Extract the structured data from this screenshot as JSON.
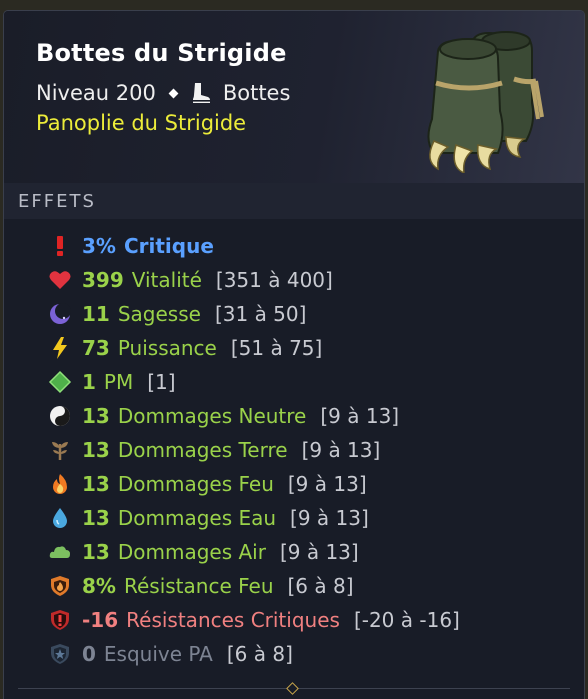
{
  "item": {
    "name": "Bottes du Strigide",
    "level_text": "Niveau 200",
    "type": "Bottes",
    "set": "Panoplie du Strigide"
  },
  "section_title": "EFFETS",
  "effects": [
    {
      "value": "3%",
      "label": "Critique",
      "range": "",
      "color": "#5aa0ff",
      "icon": "critical-icon"
    },
    {
      "value": "399",
      "label": "Vitalité",
      "range": "[351 à 400]",
      "color": "#9ad24a",
      "icon": "heart-icon"
    },
    {
      "value": "11",
      "label": "Sagesse",
      "range": "[31 à 50]",
      "color": "#9ad24a",
      "icon": "moon-icon"
    },
    {
      "value": "73",
      "label": "Puissance",
      "range": "[51 à 75]",
      "color": "#9ad24a",
      "icon": "lightning-icon"
    },
    {
      "value": "1",
      "label": "PM",
      "range": "[1]",
      "color": "#9ad24a",
      "icon": "pm-diamond-icon"
    },
    {
      "value": "13",
      "label": "Dommages Neutre",
      "range": "[9 à 13]",
      "color": "#9ad24a",
      "icon": "yin-yang-icon"
    },
    {
      "value": "13",
      "label": "Dommages Terre",
      "range": "[9 à 13]",
      "color": "#9ad24a",
      "icon": "earth-sprout-icon"
    },
    {
      "value": "13",
      "label": "Dommages Feu",
      "range": "[9 à 13]",
      "color": "#9ad24a",
      "icon": "fire-icon"
    },
    {
      "value": "13",
      "label": "Dommages Eau",
      "range": "[9 à 13]",
      "color": "#9ad24a",
      "icon": "water-drop-icon"
    },
    {
      "value": "13",
      "label": "Dommages Air",
      "range": "[9 à 13]",
      "color": "#9ad24a",
      "icon": "air-cloud-icon"
    },
    {
      "value": "8%",
      "label": "Résistance Feu",
      "range": "[6 à 8]",
      "color": "#9ad24a",
      "icon": "fire-shield-icon"
    },
    {
      "value": "-16",
      "label": "Résistances Critiques",
      "range": "[-20 à -16]",
      "color": "#f08080",
      "icon": "critical-shield-icon"
    },
    {
      "value": "0",
      "label": "Esquive PA",
      "range": "[6 à 8]",
      "color": "#7d8493",
      "icon": "dodge-shield-icon"
    }
  ]
}
